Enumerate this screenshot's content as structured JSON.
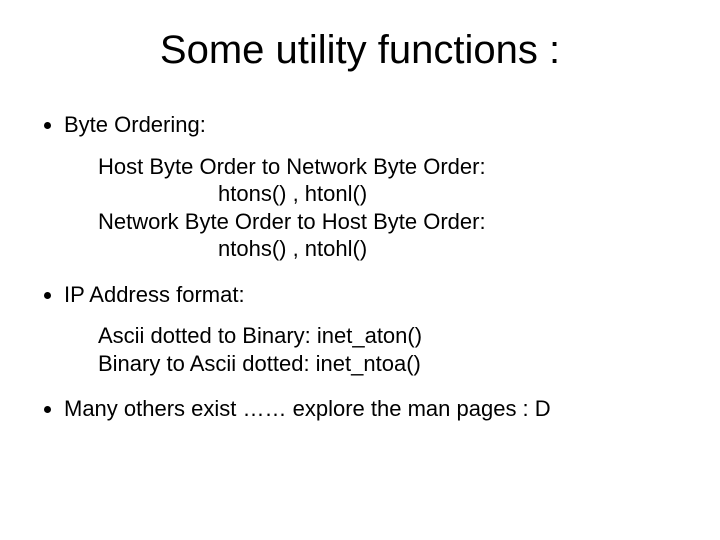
{
  "title": "Some utility functions :",
  "bullets": {
    "b1": "Byte Ordering:",
    "b1_sub": {
      "l1": "Host Byte Order to Network Byte Order:",
      "l2": "htons() , htonl()",
      "l3": "Network Byte Order to Host Byte Order:",
      "l4": "ntohs() , ntohl()"
    },
    "b2": "IP Address format:",
    "b2_sub": {
      "l1": "Ascii dotted to Binary: inet_aton()",
      "l2": "Binary to Ascii dotted: inet_ntoa()"
    },
    "b3": "Many others exist …… explore the man pages : D"
  }
}
